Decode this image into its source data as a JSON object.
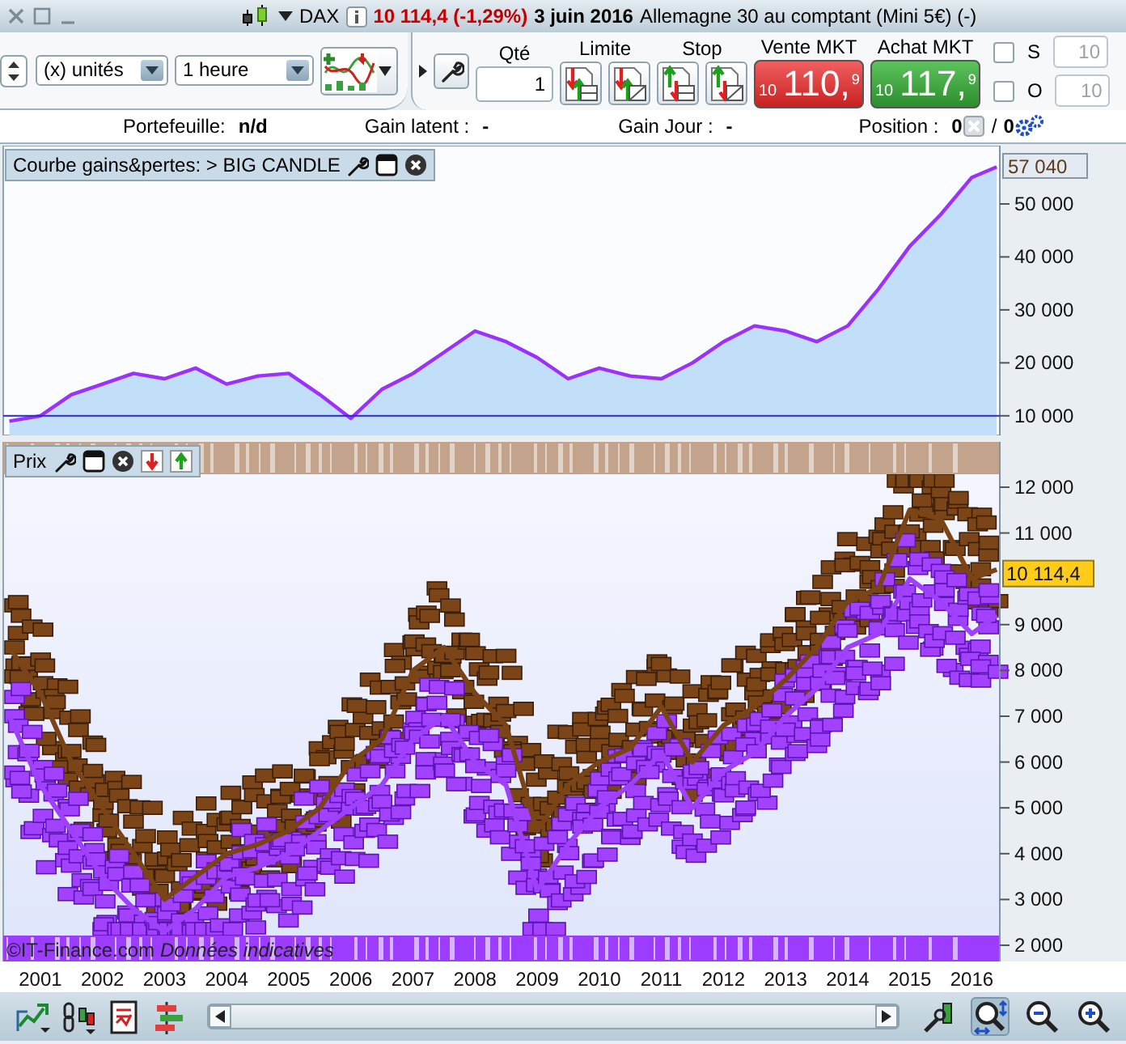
{
  "window": {
    "instrument": "DAX",
    "quote": "10 114,4 (-1,29%)",
    "date": "3 juin 2016",
    "description": "Allemagne 30 au comptant (Mini 5€) (-)"
  },
  "toolbar": {
    "units": "(x) unités",
    "period": "1 heure",
    "qty_label": "Qté",
    "qty_value": "1",
    "limit_label": "Limite",
    "stop_label": "Stop",
    "sell": {
      "label": "Vente MKT",
      "prefix": "10",
      "main": "110,",
      "sup": "9"
    },
    "buy": {
      "label": "Achat MKT",
      "prefix": "10",
      "main": "117,",
      "sup": "9"
    },
    "options": [
      {
        "label": "S",
        "checked": false,
        "placeholder": "10"
      },
      {
        "label": "O",
        "checked": false,
        "placeholder": "10"
      }
    ]
  },
  "summary": [
    {
      "label": "Portefeuille:",
      "value": "n/d"
    },
    {
      "label": "Gain latent :",
      "value": "-"
    },
    {
      "label": "Gain Jour :",
      "value": "-"
    }
  ],
  "position": {
    "label": "Position :",
    "value": "0",
    "separator": "/",
    "orders": "0"
  },
  "equity_panel": {
    "title": "Courbe gains&pertes: > BIG CANDLE",
    "last_value": "57 040",
    "chart_data": {
      "type": "area",
      "x": [
        2000.5,
        2001,
        2001.5,
        2002,
        2002.5,
        2003,
        2003.5,
        2004,
        2004.5,
        2005,
        2005.5,
        2006,
        2006.5,
        2007,
        2007.5,
        2008,
        2008.5,
        2009,
        2009.5,
        2010,
        2010.5,
        2011,
        2011.5,
        2012,
        2012.5,
        2013,
        2013.5,
        2014,
        2014.5,
        2015,
        2015.5,
        2016,
        2016.4
      ],
      "series": [
        {
          "color": "#9b30ff",
          "values": [
            9000,
            10000,
            14000,
            16000,
            18000,
            17000,
            19000,
            16000,
            17500,
            18000,
            14000,
            9500,
            15000,
            18000,
            22000,
            26000,
            24000,
            21000,
            17000,
            19000,
            17500,
            17000,
            20000,
            24000,
            27000,
            26000,
            24000,
            27000,
            34000,
            42000,
            48000,
            55000,
            57000
          ]
        }
      ],
      "xlim": [
        2000.35,
        2016.45
      ],
      "ylim": [
        6300,
        61000
      ],
      "yticks": [
        {
          "value": 10000,
          "label": "10 000"
        },
        {
          "value": 20000,
          "label": "20 000"
        },
        {
          "value": 30000,
          "label": "30 000"
        },
        {
          "value": 40000,
          "label": "40 000"
        },
        {
          "value": 50000,
          "label": "50 000"
        }
      ]
    }
  },
  "price_panel": {
    "title": "Prix",
    "last_price": "10 114,4",
    "chart_data": {
      "type": "line",
      "x": [
        2000.5,
        2001,
        2001.5,
        2002,
        2002.5,
        2003,
        2003.5,
        2004,
        2004.5,
        2005,
        2005.5,
        2006,
        2006.5,
        2007,
        2007.5,
        2008,
        2008.5,
        2009,
        2009.5,
        2010,
        2010.5,
        2011,
        2011.5,
        2012,
        2012.5,
        2013,
        2013.5,
        2014,
        2014.5,
        2015,
        2015.5,
        2016,
        2016.4
      ],
      "series": [
        {
          "color": "#7a4417",
          "values": [
            8500,
            7500,
            6000,
            5000,
            4000,
            3000,
            3500,
            4000,
            4200,
            4500,
            5000,
            6000,
            6500,
            8000,
            8500,
            7500,
            6800,
            4500,
            5500,
            6000,
            6300,
            7200,
            6000,
            6800,
            7200,
            7800,
            8500,
            9500,
            9800,
            11500,
            11300,
            10000,
            10200
          ]
        },
        {
          "color": "#a040ff",
          "values": [
            7000,
            5500,
            4500,
            3500,
            2800,
            2300,
            2800,
            3500,
            3700,
            4000,
            4500,
            5000,
            5500,
            6500,
            7000,
            6000,
            5500,
            3200,
            4200,
            5000,
            5500,
            6200,
            5000,
            5800,
            6200,
            7000,
            7600,
            8500,
            8800,
            10000,
            9500,
            8800,
            9200
          ]
        }
      ],
      "xlim": [
        2000.35,
        2016.45
      ],
      "ylim": [
        1647,
        12989
      ],
      "xticks": [
        {
          "value": 2001,
          "label": "2001"
        },
        {
          "value": 2002,
          "label": "2002"
        },
        {
          "value": 2003,
          "label": "2003"
        },
        {
          "value": 2004,
          "label": "2004"
        },
        {
          "value": 2005,
          "label": "2005"
        },
        {
          "value": 2006,
          "label": "2006"
        },
        {
          "value": 2007,
          "label": "2007"
        },
        {
          "value": 2008,
          "label": "2008"
        },
        {
          "value": 2009,
          "label": "2009"
        },
        {
          "value": 2010,
          "label": "2010"
        },
        {
          "value": 2011,
          "label": "2011"
        },
        {
          "value": 2012,
          "label": "2012"
        },
        {
          "value": 2013,
          "label": "2013"
        },
        {
          "value": 2014,
          "label": "2014"
        },
        {
          "value": 2015,
          "label": "2015"
        },
        {
          "value": 2016,
          "label": "2016"
        }
      ],
      "yticks": [
        {
          "value": 2000,
          "label": "2 000"
        },
        {
          "value": 3000,
          "label": "3 000"
        },
        {
          "value": 4000,
          "label": "4 000"
        },
        {
          "value": 5000,
          "label": "5 000"
        },
        {
          "value": 6000,
          "label": "6 000"
        },
        {
          "value": 7000,
          "label": "7 000"
        },
        {
          "value": 8000,
          "label": "8 000"
        },
        {
          "value": 9000,
          "label": "9 000"
        },
        {
          "value": 11000,
          "label": "11 000"
        },
        {
          "value": 12000,
          "label": "12 000"
        }
      ]
    }
  },
  "footer": {
    "copyright": "©IT-Finance.com",
    "disclaimer": "Données indicatives"
  },
  "bottom_toolbar": {
    "left_tools": [
      {
        "selected": false
      },
      {
        "selected": false
      },
      {
        "selected": false
      },
      {
        "selected": false
      }
    ],
    "right_tools": [
      {
        "selected": false
      },
      {
        "selected": true
      },
      {
        "selected": false
      },
      {
        "selected": false
      }
    ]
  }
}
